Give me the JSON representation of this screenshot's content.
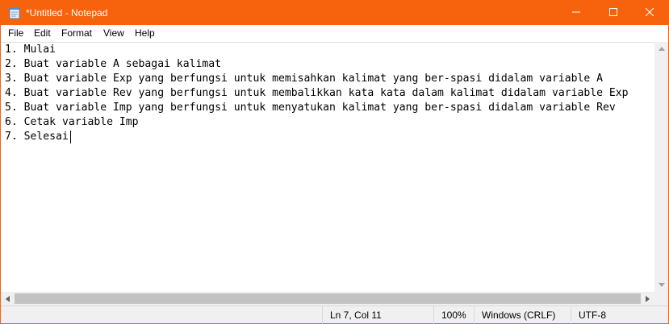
{
  "window": {
    "title": "*Untitled - Notepad",
    "accent_color": "#f7630c",
    "icons": {
      "app": "notepad-icon",
      "minimize": "minimize-icon",
      "maximize": "maximize-icon",
      "close": "close-icon"
    }
  },
  "menu": {
    "items": [
      "File",
      "Edit",
      "Format",
      "View",
      "Help"
    ]
  },
  "editor": {
    "lines": [
      "1. Mulai",
      "2. Buat variable A sebagai kalimat",
      "3. Buat variable Exp yang berfungsi untuk memisahkan kalimat yang ber-spasi didalam variable A",
      "4. Buat variable Rev yang berfungsi untuk membalikkan kata kata dalam kalimat didalam variable Exp",
      "5. Buat variable Imp yang berfungsi untuk menyatukan kalimat yang ber-spasi didalam variable Rev",
      "6. Cetak variable Imp",
      "7. Selesai"
    ]
  },
  "status": {
    "position": "Ln 7, Col 11",
    "zoom": "100%",
    "line_ending": "Windows (CRLF)",
    "encoding": "UTF-8"
  }
}
